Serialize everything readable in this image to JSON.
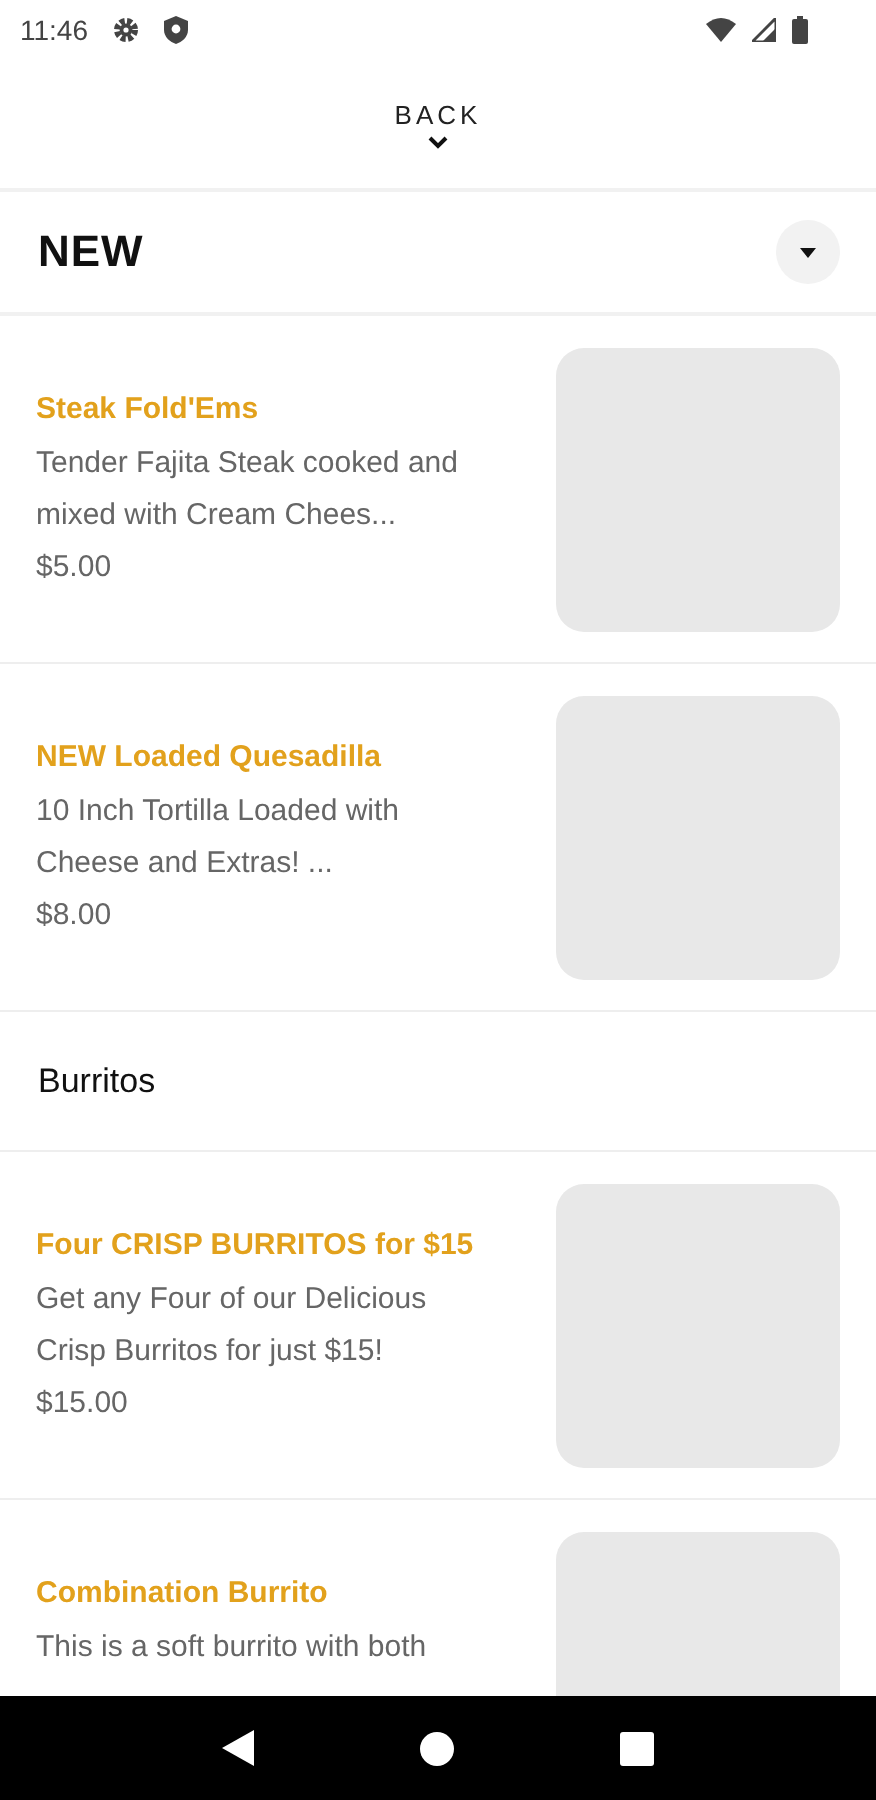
{
  "status_bar": {
    "time": "11:46"
  },
  "back": {
    "label": "BACK"
  },
  "category_selector": {
    "label": "NEW"
  },
  "entries": [
    {
      "kind": "item",
      "name": "Steak Fold'Ems",
      "description": "Tender Fajita Steak cooked and mixed with Cream Chees...",
      "price": "$5.00"
    },
    {
      "kind": "item",
      "name": "NEW Loaded Quesadilla",
      "description": "10 Inch Tortilla Loaded with Cheese and Extras!  ...",
      "price": "$8.00"
    },
    {
      "kind": "heading",
      "name": "Burritos"
    },
    {
      "kind": "item",
      "name": "Four CRISP BURRITOS for $15",
      "description": "Get any Four of our Delicious Crisp Burritos for just $15!",
      "price": "$15.00"
    },
    {
      "kind": "item",
      "name": "Combination Burrito",
      "description": "This is a soft burrito with both"
    }
  ]
}
